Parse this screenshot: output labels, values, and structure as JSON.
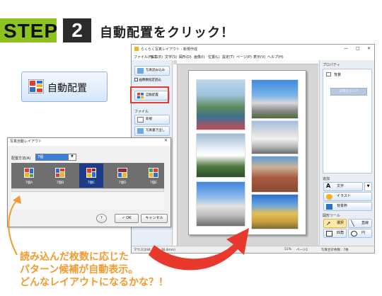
{
  "step": {
    "word": "STEP",
    "number": "2",
    "title": "自動配置をクリック！"
  },
  "colors": {
    "step_green": "#8dc21f",
    "step_dark": "#2b2b2b",
    "highlight_red": "#e8392c",
    "caption_orange": "#f39a2d"
  },
  "big_button": {
    "label": "自動配置",
    "icon": "auto-layout-icon"
  },
  "window": {
    "title": "らくらく写真レイアウト - 新規作成",
    "controls": [
      "—",
      "□",
      "✕"
    ],
    "menu": [
      "ファイル(F)",
      "編集(E)",
      "文字(S)",
      "図形(D)",
      "画像(I)",
      "位置(L)",
      "設定(T)",
      "ページ(P)",
      "表示(V)",
      "ヘルプ(H)"
    ],
    "sidebar": {
      "buttons_top": [
        {
          "label": "写真読み込み",
          "icon": "photo-import-icon"
        },
        {
          "label": "画像数指定読込",
          "icon": "checkbox-icon"
        },
        {
          "label": "自動配置",
          "icon": "auto-layout-icon"
        }
      ],
      "file_heading": "ファイル",
      "file_buttons": [
        {
          "label": "新規",
          "icon": "new-file-icon"
        },
        {
          "label": "写真書き出し",
          "icon": "export-icon"
        }
      ]
    },
    "right_panel": {
      "properties_heading": "プロパティ",
      "background_label": "背景",
      "property_button": "背景をクリア",
      "add_heading": "追加",
      "add_buttons": [
        {
          "label": "文字",
          "icon": "text-icon"
        },
        {
          "label": "イラスト",
          "icon": "illustration-icon"
        },
        {
          "label": "背景枠",
          "icon": "frame-icon"
        }
      ],
      "tools_heading": "図形ツール",
      "tool_buttons": [
        {
          "label": "選択",
          "icon": "select-icon"
        },
        {
          "label": "直線",
          "icon": "line-icon"
        },
        {
          "label": "四角",
          "icon": "rectangle-icon"
        },
        {
          "label": "円",
          "icon": "circle-icon"
        }
      ]
    },
    "status": {
      "left": "マウス(194.1mm,38.4mm)",
      "zoom": "51%",
      "page": "ページ1",
      "right": "写真合計枚数 : 7枚"
    }
  },
  "dialog": {
    "title": "写真自動レイアウト",
    "close": "✕",
    "layout_label": "配置方法(A)",
    "layout_value": "7個",
    "patterns": [
      {
        "label": "7個A",
        "selected": false
      },
      {
        "label": "7個B",
        "selected": false
      },
      {
        "label": "7個C",
        "selected": true
      },
      {
        "label": "7個D",
        "selected": false
      },
      {
        "label": "7個E",
        "selected": false
      }
    ],
    "help_button": "?",
    "ok_button": "OK",
    "cancel_button": "キャンセル"
  },
  "caption": {
    "line1": "読み込んだ枚数に応じた",
    "line2": "パターン候補が自動表示。",
    "line3": "どんなレイアウトになるかな？！"
  }
}
